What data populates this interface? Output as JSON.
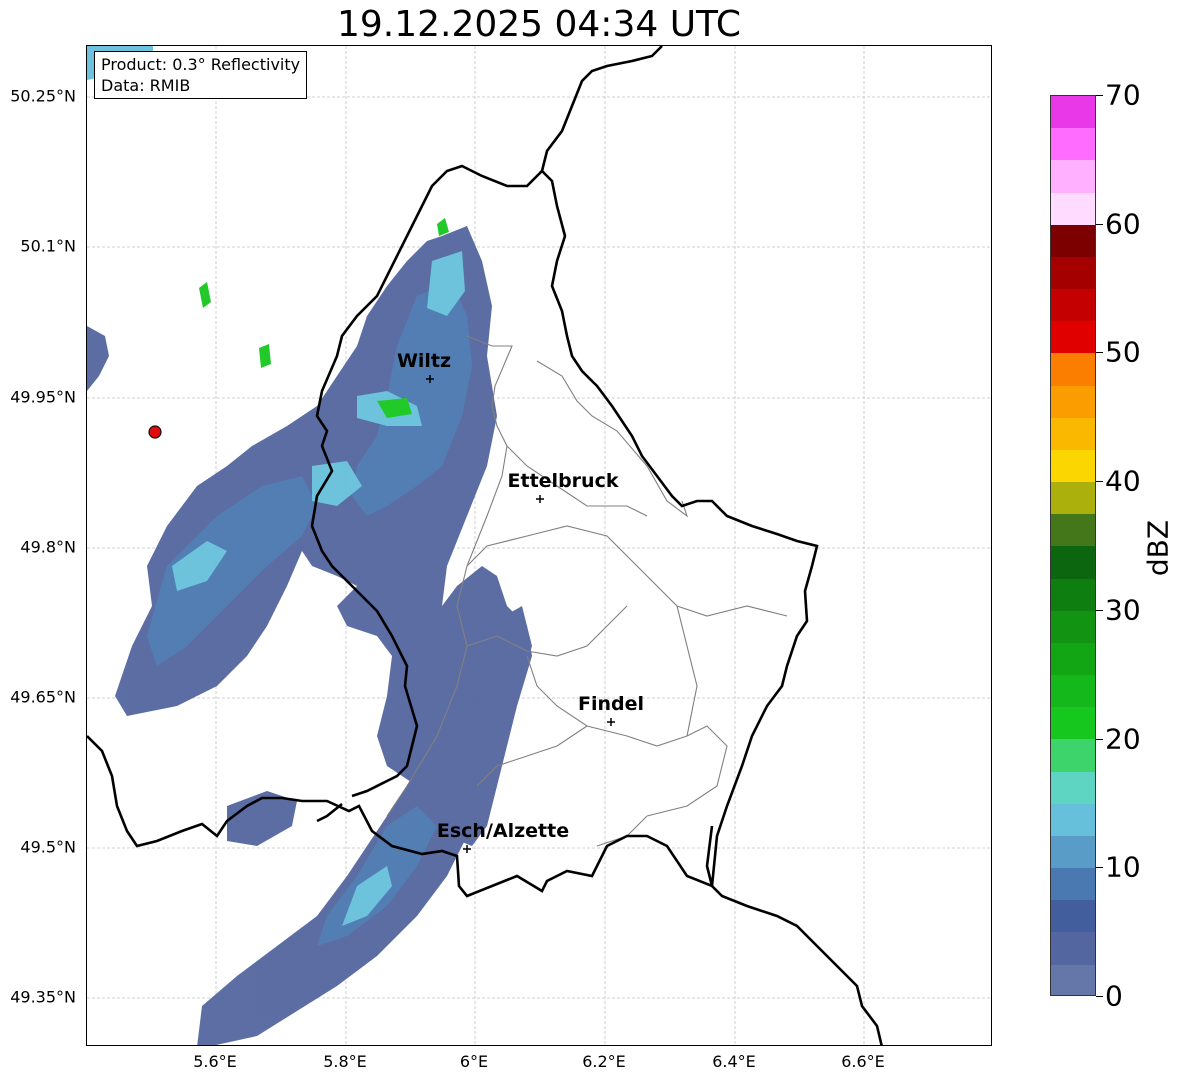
{
  "title": "19.12.2025 04:34 UTC",
  "info": {
    "product": "Product: 0.3° Reflectivity",
    "data": "Data: RMIB"
  },
  "lat_ticks": [
    "50.25°N",
    "50.1°N",
    "49.95°N",
    "49.8°N",
    "49.65°N",
    "49.5°N",
    "49.35°N"
  ],
  "lon_ticks": [
    "5.6°E",
    "5.8°E",
    "6°E",
    "6.2°E",
    "6.4°E",
    "6.6°E"
  ],
  "cities": [
    {
      "name": "Wiltz"
    },
    {
      "name": "Ettelbruck"
    },
    {
      "name": "Findel"
    },
    {
      "name": "Esch/Alzette"
    }
  ],
  "colorbar": {
    "label": "dBZ",
    "ticks": [
      "0",
      "10",
      "20",
      "30",
      "40",
      "50",
      "60",
      "70"
    ],
    "min": 0,
    "max": 70,
    "step": 2.5,
    "colors": [
      "#6577a8",
      "#5466a0",
      "#435e9d",
      "#4a78b0",
      "#5a9cc8",
      "#66bfdb",
      "#5ed4c3",
      "#3dd46c",
      "#16c81e",
      "#14b81a",
      "#12a614",
      "#129412",
      "#0e7e10",
      "#0c6610",
      "#44761a",
      "#acb00c",
      "#fbd600",
      "#fbb800",
      "#fb9c00",
      "#fb7e00",
      "#e00000",
      "#c40000",
      "#a40000",
      "#7c0000",
      "#ffdcff",
      "#ffb0ff",
      "#ff6cff",
      "#e838e8"
    ]
  },
  "colors": {
    "echo_low": "#5466a0",
    "echo_mid": "#4a78b0",
    "echo_high": "#66bfdb",
    "echo_peak": "#16c81e",
    "border": "#000000",
    "canton": "#808080",
    "grid": "#c0c0c0"
  }
}
